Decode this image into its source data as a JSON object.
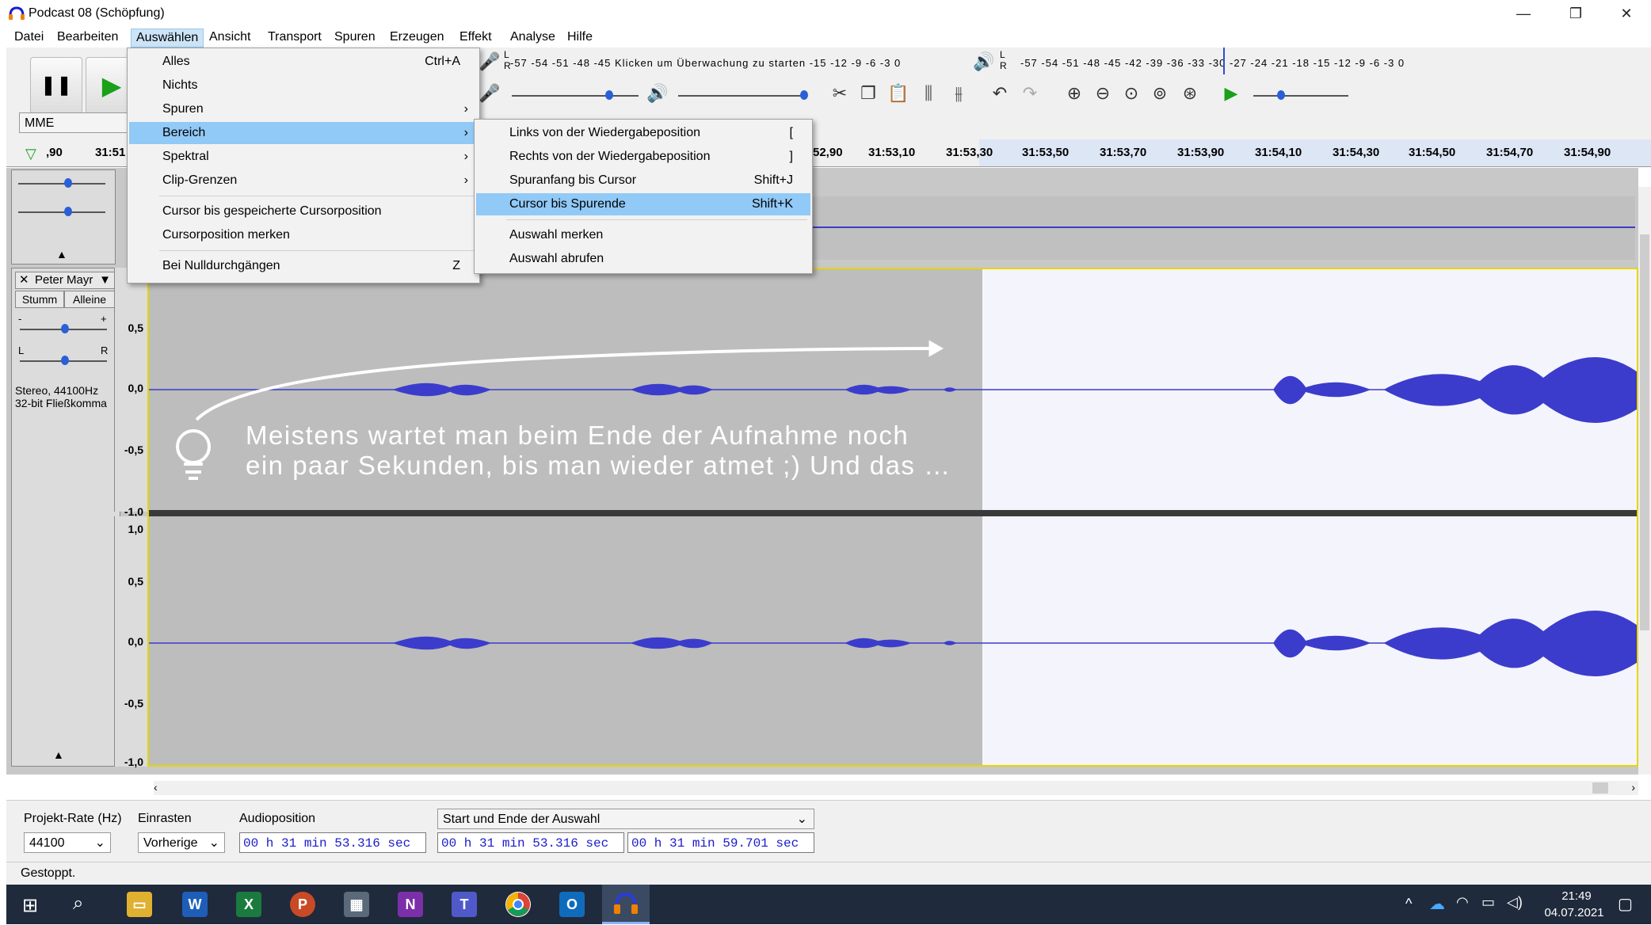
{
  "window": {
    "title": "Podcast 08 (Schöpfung)",
    "minimize": "—",
    "restore": "❐",
    "close": "✕"
  },
  "menubar": [
    "Datei",
    "Bearbeiten",
    "Auswählen",
    "Ansicht",
    "Transport",
    "Spuren",
    "Erzeugen",
    "Effekt",
    "Analyse",
    "Hilfe"
  ],
  "menu_auswaehlen": {
    "items": [
      {
        "label": "Alles",
        "shortcut": "Ctrl+A"
      },
      {
        "label": "Nichts",
        "shortcut": ""
      },
      {
        "label": "Spuren",
        "shortcut": "",
        "submenu": true
      },
      {
        "label": "Bereich",
        "shortcut": "",
        "submenu": true,
        "highlighted": true
      },
      {
        "label": "Spektral",
        "shortcut": "",
        "submenu": true
      },
      {
        "label": "Clip-Grenzen",
        "shortcut": "",
        "submenu": true
      },
      {
        "label": "Cursor bis gespeicherte Cursorposition",
        "shortcut": ""
      },
      {
        "label": "Cursorposition merken",
        "shortcut": ""
      },
      {
        "label": "Bei Nulldurchgängen",
        "shortcut": "Z"
      }
    ],
    "arrow": "›"
  },
  "submenu_bereich": {
    "items": [
      {
        "label": "Links von der Wiedergabeposition",
        "shortcut": "["
      },
      {
        "label": "Rechts von der Wiedergabeposition",
        "shortcut": "]"
      },
      {
        "label": "Spuranfang bis Cursor",
        "shortcut": "Shift+J"
      },
      {
        "label": "Cursor bis Spurende",
        "shortcut": "Shift+K",
        "highlighted": true
      },
      {
        "label": "Auswahl merken",
        "shortcut": ""
      },
      {
        "label": "Auswahl abrufen",
        "shortcut": ""
      }
    ]
  },
  "toolbar": {
    "pause_icon": "❚❚",
    "play_icon": "▶",
    "host": "MME",
    "record_meter_scale": "-57 -54 -51 -48 -45  Klicken um Überwachung zu starten  -15 -12  -9  -6  -3  0",
    "playback_meter_scale": "-57 -54 -51 -48 -45 -42 -39 -36 -33 -30 -27 -24 -21 -18 -15 -12  -9  -6  -3  0",
    "meter_lr": [
      "L",
      "R"
    ]
  },
  "timeline": {
    "left_labels": [
      ",90",
      "31:51"
    ],
    "labels": [
      "52,90",
      "31:53,10",
      "31:53,30",
      "31:53,50",
      "31:53,70",
      "31:53,90",
      "31:54,10",
      "31:54,30",
      "31:54,50",
      "31:54,70",
      "31:54,90"
    ]
  },
  "track": {
    "name": "Peter Mayr",
    "mute": "Stumm",
    "solo": "Alleine",
    "info_line1": "Stereo, 44100Hz",
    "info_line2": "32-bit Fließkomma",
    "pan_l": "L",
    "pan_r": "R",
    "gain_minus": "-",
    "gain_plus": "+",
    "close": "✕",
    "collapse": "▲",
    "ruler_top": [
      "0,5",
      "0,0",
      "-0,5",
      "-1,0"
    ],
    "ruler_bottom": [
      "1,0",
      "0,5",
      "0,0",
      "-0,5",
      "-1,0"
    ]
  },
  "annotation": {
    "line1": "Meistens wartet man beim Ende der Aufnahme noch",
    "line2": "ein paar Sekunden, bis man wieder atmet ;) Und das …"
  },
  "selection_toolbar": {
    "rate_label": "Projekt-Rate (Hz)",
    "rate_value": "44100",
    "snap_label": "Einrasten",
    "snap_value": "Vorherige",
    "audiopos_label": "Audioposition",
    "audiopos_value": "00 h 31 min 53.316 sec",
    "range_label": "Start und Ende der Auswahl",
    "start_value": "00 h 31 min 53.316 sec",
    "end_value": "00 h 31 min 59.701 sec"
  },
  "status": {
    "text": "Gestoppt."
  },
  "taskbar": {
    "time": "21:49",
    "date": "04.07.2021",
    "apps": [
      "W",
      "X",
      "P",
      "N",
      "T",
      "O"
    ]
  },
  "colors": {
    "selection_bg": "#f4f4fc",
    "unselected_bg": "#bdbdbd",
    "waveform": "#3c3ccc",
    "menu_highlight": "#91c9f7",
    "taskbar": "#1f2a3c"
  }
}
